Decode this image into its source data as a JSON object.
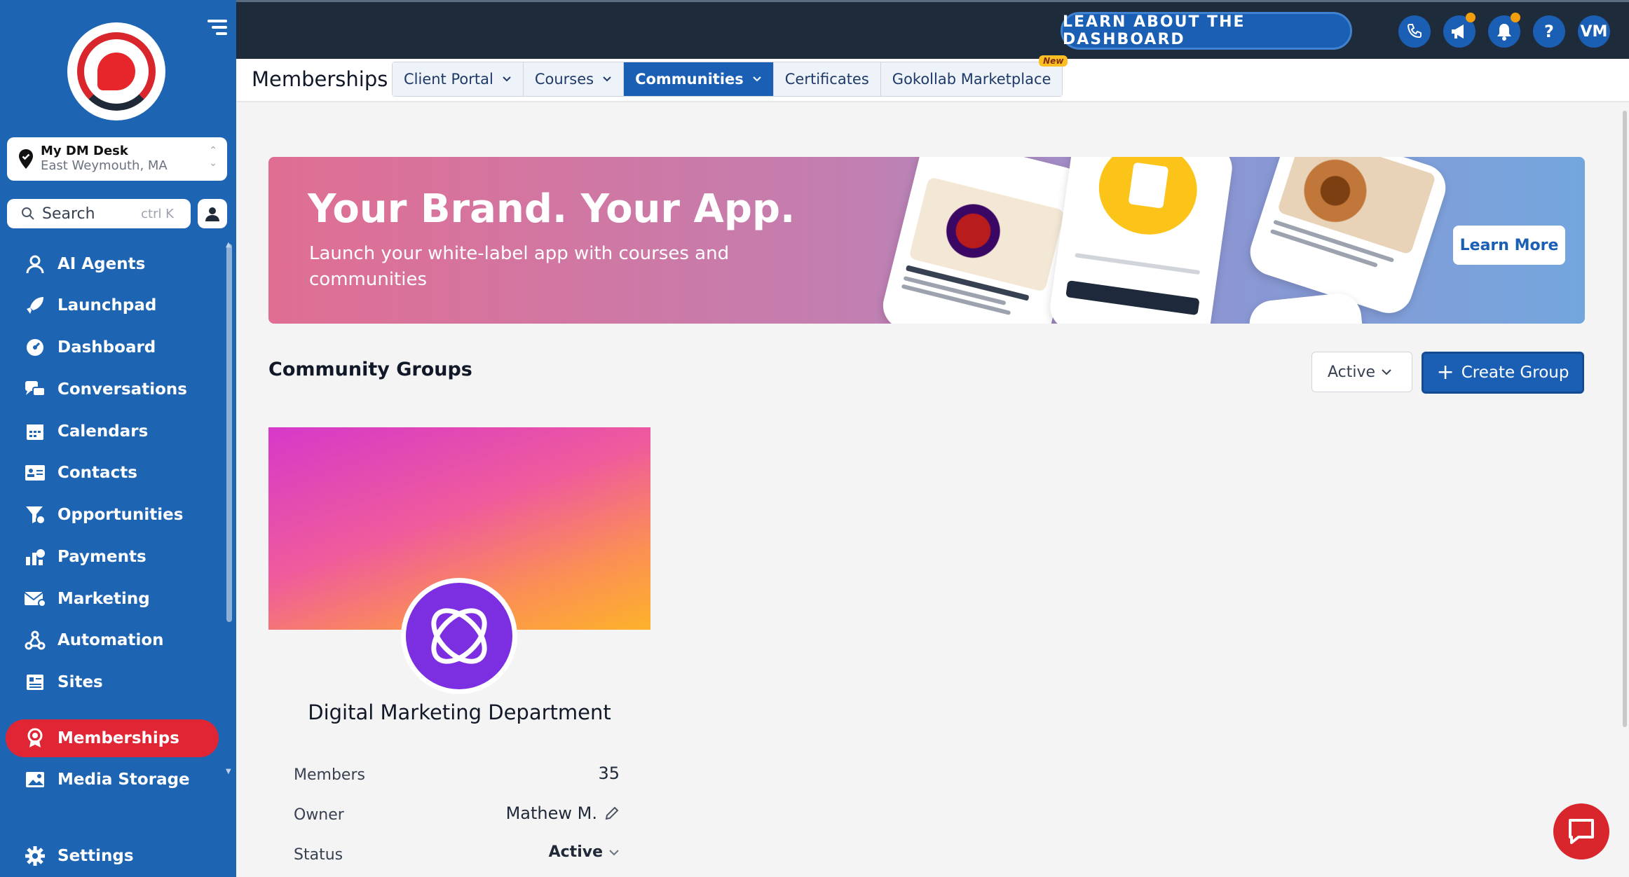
{
  "sidebar": {
    "location": {
      "name": "My DM Desk",
      "address": "East Weymouth, MA"
    },
    "search": {
      "label": "Search",
      "shortcut": "ctrl K"
    },
    "items": [
      {
        "label": "AI Agents",
        "icon": "ai-agent-icon"
      },
      {
        "label": "Launchpad",
        "icon": "rocket-icon"
      },
      {
        "label": "Dashboard",
        "icon": "dashboard-gauge-icon"
      },
      {
        "label": "Conversations",
        "icon": "chat-bubbles-icon"
      },
      {
        "label": "Calendars",
        "icon": "calendar-icon"
      },
      {
        "label": "Contacts",
        "icon": "contact-card-icon"
      },
      {
        "label": "Opportunities",
        "icon": "funnel-icon"
      },
      {
        "label": "Payments",
        "icon": "payments-icon"
      },
      {
        "label": "Marketing",
        "icon": "envelope-icon"
      },
      {
        "label": "Automation",
        "icon": "automation-icon"
      },
      {
        "label": "Sites",
        "icon": "sites-icon"
      },
      {
        "label": "Memberships",
        "icon": "membership-badge-icon",
        "active": true
      },
      {
        "label": "Media Storage",
        "icon": "image-icon"
      }
    ],
    "settings": {
      "label": "Settings",
      "icon": "gear-icon"
    }
  },
  "topbar": {
    "learn_label": "LEARN ABOUT THE DASHBOARD",
    "avatar_initials": "VM",
    "help_label": "?"
  },
  "header": {
    "title": "Memberships",
    "tabs": [
      {
        "label": "Client Portal",
        "dropdown": true
      },
      {
        "label": "Courses",
        "dropdown": true
      },
      {
        "label": "Communities",
        "dropdown": true,
        "active": true
      },
      {
        "label": "Certificates",
        "dropdown": false
      },
      {
        "label": "Gokollab Marketplace",
        "dropdown": false,
        "badge": "New"
      }
    ]
  },
  "banner": {
    "title": "Your Brand. Your App.",
    "subtitle": "Launch your white-label app with courses and communities",
    "cta": "Learn More"
  },
  "groups": {
    "title": "Community Groups",
    "filter_value": "Active",
    "create_label": "Create Group",
    "cards": [
      {
        "name": "Digital Marketing Department",
        "members_label": "Members",
        "members_value": "35",
        "owner_label": "Owner",
        "owner_value": "Mathew M.",
        "status_label": "Status",
        "status_value": "Active"
      }
    ]
  },
  "colors": {
    "sidebar": "#1d64b3",
    "topbar": "#1e2b3b",
    "accent": "#1a5fb4",
    "active_nav": "#e02634"
  }
}
